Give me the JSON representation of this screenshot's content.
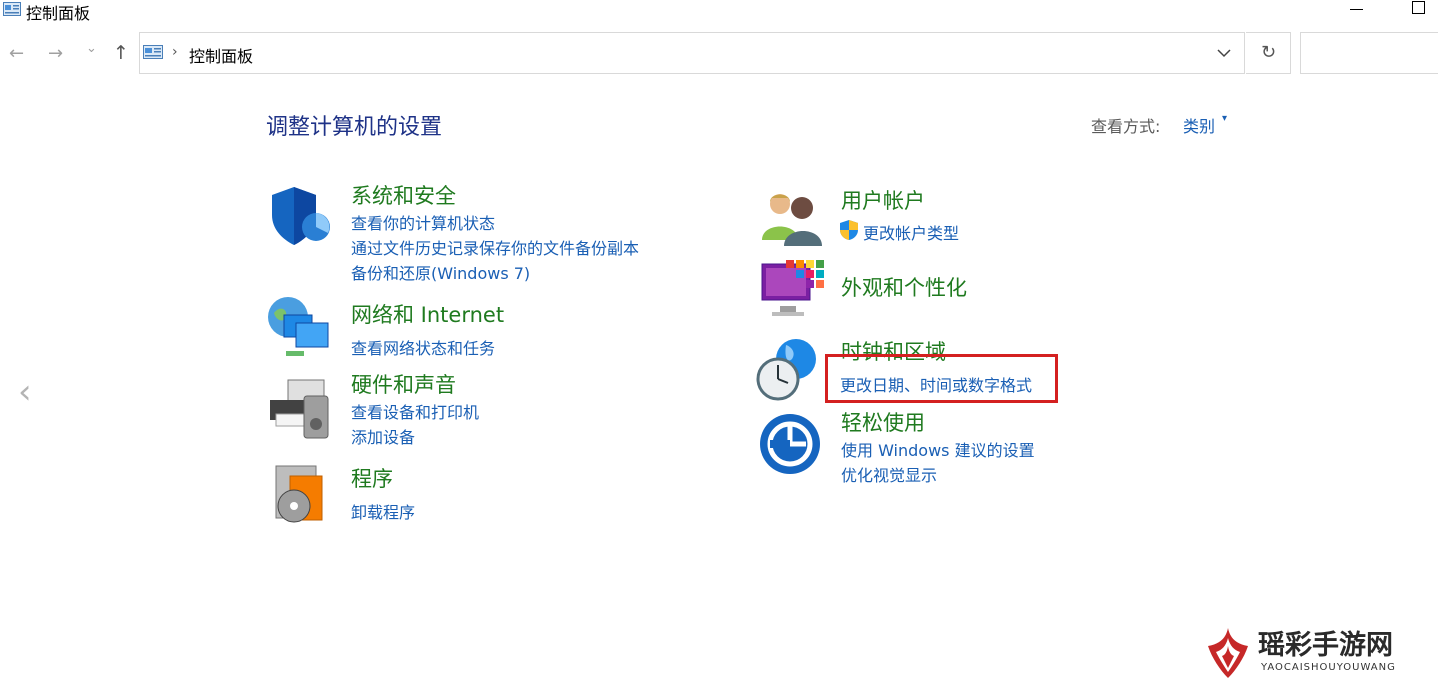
{
  "window": {
    "title": "控制面板"
  },
  "nav": {
    "back": "←",
    "forward": "→",
    "recent": "⌄",
    "up": "↑",
    "address_chevron": "›",
    "address": "控制面板",
    "refresh": "↻"
  },
  "header": {
    "title": "调整计算机的设置",
    "view_by_label": "查看方式:",
    "view_by_value": "类别"
  },
  "categories": {
    "system": {
      "title": "系统和安全",
      "links": [
        "查看你的计算机状态",
        "通过文件历史记录保存你的文件备份副本",
        "备份和还原(Windows 7)"
      ]
    },
    "network": {
      "title": "网络和 Internet",
      "links": [
        "查看网络状态和任务"
      ]
    },
    "hardware": {
      "title": "硬件和声音",
      "links": [
        "查看设备和打印机",
        "添加设备"
      ]
    },
    "programs": {
      "title": "程序",
      "links": [
        "卸载程序"
      ]
    },
    "accounts": {
      "title": "用户帐户",
      "links": [
        "更改帐户类型"
      ]
    },
    "appearance": {
      "title": "外观和个性化",
      "links": []
    },
    "clock": {
      "title": "时钟和区域",
      "links": [
        "更改日期、时间或数字格式"
      ]
    },
    "ease": {
      "title": "轻松使用",
      "links": [
        "使用 Windows 建议的设置",
        "优化视觉显示"
      ]
    }
  },
  "side": {
    "left_arrow": "‹"
  },
  "watermark": {
    "name": "瑶彩手游网",
    "sub": "YAOCAISHOUYOUWANG"
  },
  "colors": {
    "link": "#1a5fb4",
    "category": "#1f7a1f",
    "heading": "#1e3287",
    "highlight": "#d42020"
  }
}
